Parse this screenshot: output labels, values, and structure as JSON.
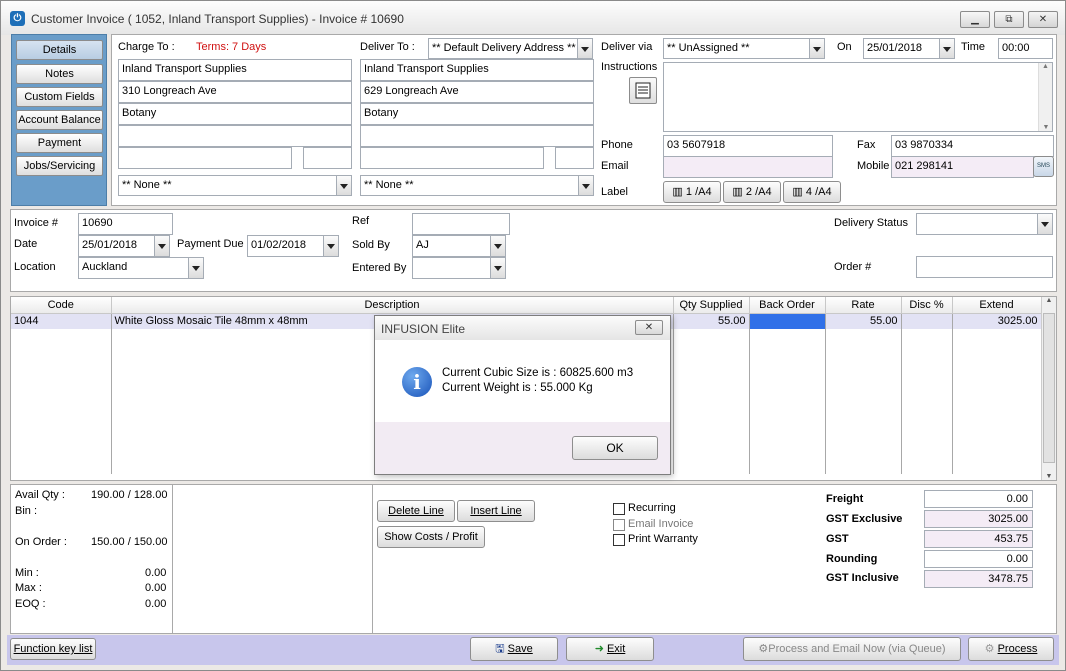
{
  "window": {
    "title": "Customer Invoice ( 1052, Inland Transport Supplies) - Invoice # 10690",
    "minimize": "▭",
    "restore": "⧉",
    "close": "✕"
  },
  "nav": {
    "items": [
      {
        "label": "Details"
      },
      {
        "label": "Notes"
      },
      {
        "label": "Custom Fields"
      },
      {
        "label": "Account Balance"
      },
      {
        "label": "Payment"
      },
      {
        "label": "Jobs/Servicing"
      }
    ]
  },
  "charge_to": {
    "label": "Charge To :",
    "terms": "Terms: 7 Days",
    "name": "Inland Transport Supplies",
    "address1": "310 Longreach Ave",
    "address2": "Botany",
    "contact": "** None **"
  },
  "deliver_to": {
    "label": "Deliver To :",
    "address_select": "** Default Delivery Address **",
    "name": "Inland Transport Supplies",
    "address1": "629 Longreach Ave",
    "address2": "Botany",
    "contact": "** None **"
  },
  "delivery": {
    "via_label": "Deliver via",
    "via_value": "** UnAssigned **",
    "on_label": "On",
    "on_value": "25/01/2018",
    "time_label": "Time",
    "time_value": "00:00",
    "instructions_label": "Instructions",
    "phone_label": "Phone",
    "phone_value": "03 5607918",
    "fax_label": "Fax",
    "fax_value": "03 9870334",
    "email_label": "Email",
    "email_value": "",
    "mobile_label": "Mobile",
    "mobile_value": "021 298141",
    "sms_label": "SMS",
    "label_label": "Label",
    "label_buttons": [
      "1 /A4",
      "2 /A4",
      "4 /A4"
    ]
  },
  "invoice": {
    "number_label": "Invoice #",
    "number_value": "10690",
    "date_label": "Date",
    "date_value": "25/01/2018",
    "payment_due_label": "Payment Due",
    "payment_due_value": "01/02/2018",
    "location_label": "Location",
    "location_value": "Auckland",
    "ref_label": "Ref",
    "ref_value": "",
    "sold_by_label": "Sold By",
    "sold_by_value": "AJ",
    "entered_by_label": "Entered By",
    "entered_by_value": "",
    "delivery_status_label": "Delivery Status",
    "delivery_status_value": "",
    "order_label": "Order #",
    "order_value": ""
  },
  "grid": {
    "headers": [
      "Code",
      "Description",
      "Qty Supplied",
      "Back Order",
      "Rate",
      "Disc %",
      "Extend"
    ],
    "rows": [
      {
        "code": "1044",
        "description": "White Gloss Mosaic Tile 48mm x 48mm",
        "qty": "55.00",
        "back_order": "",
        "rate": "55.00",
        "disc": "",
        "extend": "3025.00"
      }
    ]
  },
  "dialog": {
    "title": "INFUSION Elite",
    "line1": "Current Cubic Size is : 60825.600 m3",
    "line2": "Current Weight is : 55.000 Kg",
    "ok": "OK",
    "close": "✕",
    "info_icon": "i"
  },
  "stock": {
    "avail_label": "Avail Qty :",
    "avail_value": "190.00 / 128.00",
    "bin_label": "Bin :",
    "on_order_label": "On Order :",
    "on_order_value": "150.00 / 150.00",
    "min_label": "Min :",
    "min_value": "0.00",
    "max_label": "Max :",
    "max_value": "0.00",
    "eoq_label": "EOQ :",
    "eoq_value": "0.00"
  },
  "line_actions": {
    "delete_line": "Delete Line",
    "insert_line": "Insert Line",
    "show_costs": "Show Costs / Profit"
  },
  "options": {
    "recurring": "Recurring",
    "email_invoice": "Email Invoice",
    "print_warranty": "Print Warranty"
  },
  "totals": {
    "freight_label": "Freight",
    "freight_value": "0.00",
    "gst_excl_label": "GST Exclusive",
    "gst_excl_value": "3025.00",
    "gst_label": "GST",
    "gst_value": "453.75",
    "rounding_label": "Rounding",
    "rounding_value": "0.00",
    "gst_incl_label": "GST Inclusive",
    "gst_incl_value": "3478.75"
  },
  "footer": {
    "function_keys": "Function key list",
    "save": "Save",
    "exit": "Exit",
    "process_email": "Process and Email Now (via Queue)",
    "process": "Process"
  }
}
